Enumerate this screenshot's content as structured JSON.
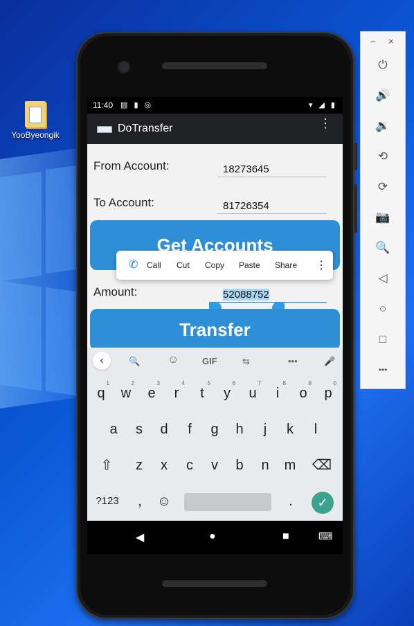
{
  "desktop": {
    "icon_label": "YooByeongik"
  },
  "status_bar": {
    "time": "11:40",
    "left_icons": "▤ ▮ ◎",
    "right_icons": "▾ ◢ ▮"
  },
  "app_bar": {
    "title": "DoTransfer",
    "menu_icon": "⋮"
  },
  "form": {
    "from_label": "From Account:",
    "from_value": "18273645",
    "to_label": "To Account:",
    "to_value": "81726354",
    "get_accounts_label": "Get Accounts",
    "amount_label": "Amount:",
    "amount_value": "52088752",
    "transfer_label": "Transfer"
  },
  "context_menu": {
    "items": [
      "Call",
      "Cut",
      "Copy",
      "Paste",
      "Share"
    ],
    "more_icon": "⋮",
    "call_icon": "phone-icon"
  },
  "keyboard": {
    "toolbar": {
      "back": "‹",
      "search": "🔍",
      "sticker": "☺",
      "gif": "GIF",
      "translate": "⇆",
      "more": "•••",
      "mic": "🎤"
    },
    "row1": [
      {
        "k": "q",
        "n": "1"
      },
      {
        "k": "w",
        "n": "2"
      },
      {
        "k": "e",
        "n": "3"
      },
      {
        "k": "r",
        "n": "4"
      },
      {
        "k": "t",
        "n": "5"
      },
      {
        "k": "y",
        "n": "6"
      },
      {
        "k": "u",
        "n": "7"
      },
      {
        "k": "i",
        "n": "8"
      },
      {
        "k": "o",
        "n": "9"
      },
      {
        "k": "p",
        "n": "0"
      }
    ],
    "row2": [
      "a",
      "s",
      "d",
      "f",
      "g",
      "h",
      "j",
      "k",
      "l"
    ],
    "row3": [
      "z",
      "x",
      "c",
      "v",
      "b",
      "n",
      "m"
    ],
    "shift": "⇧",
    "backspace": "⌫",
    "symbols": "?123",
    "comma": ",",
    "emoji": "☺",
    "period": ".",
    "enter": "✓"
  },
  "nav": {
    "back": "◀",
    "home": "●",
    "recents": "■",
    "keyboard_toggle": "⌨"
  },
  "emulator_panel": {
    "minimize": "–",
    "close": "×",
    "buttons": [
      "⏻",
      "🔊",
      "🔉",
      "⟲",
      "⟳",
      "📷",
      "🔍",
      "◁",
      "○",
      "□",
      "•••"
    ]
  },
  "colors": {
    "accent": "#2f8fd6",
    "enter_key": "#3aa28f",
    "selection": "#a9d6f5"
  }
}
